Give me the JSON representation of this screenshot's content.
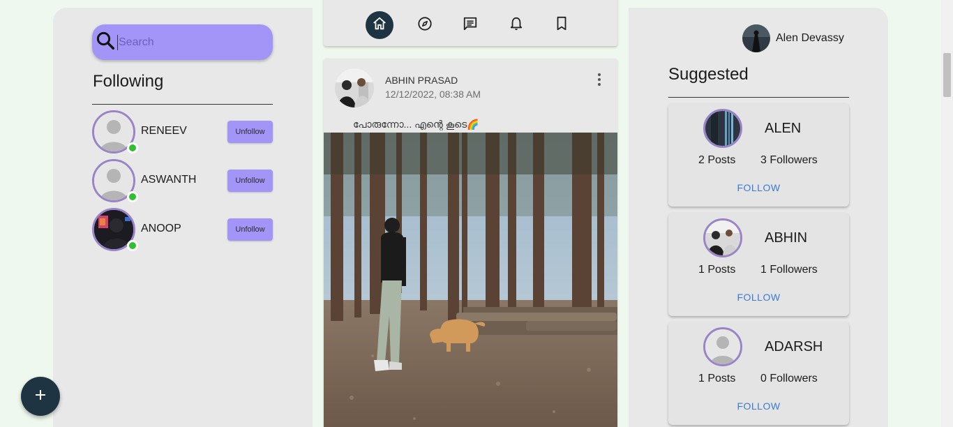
{
  "search": {
    "placeholder": "Search"
  },
  "following": {
    "title": "Following",
    "items": [
      {
        "name": "RENEEV",
        "button": "Unfollow"
      },
      {
        "name": "ASWANTH",
        "button": "Unfollow"
      },
      {
        "name": "ANOOP",
        "button": "Unfollow"
      }
    ]
  },
  "nav": {
    "items": [
      "home-icon",
      "explore-icon",
      "messages-icon",
      "notifications-icon",
      "bookmark-icon"
    ],
    "active": "home-icon"
  },
  "post": {
    "author": "ABHIN PRASAD",
    "date": "12/12/2022, 08:38 AM",
    "caption": "പോരുന്നോ... എന്റെ കൂടെ🌈"
  },
  "profile": {
    "name": "Alen Devassy"
  },
  "suggested": {
    "title": "Suggested",
    "items": [
      {
        "name": "ALEN",
        "posts": "2 Posts",
        "followers": "3 Followers",
        "action": "FOLLOW"
      },
      {
        "name": "ABHIN",
        "posts": "1 Posts",
        "followers": "1 Followers",
        "action": "FOLLOW"
      },
      {
        "name": "ADARSH",
        "posts": "1 Posts",
        "followers": "0 Followers",
        "action": "FOLLOW"
      }
    ]
  },
  "colors": {
    "accent": "#a394f7",
    "dark": "#1f3443",
    "online": "#2fbf2f",
    "link": "#3a7bd5"
  }
}
